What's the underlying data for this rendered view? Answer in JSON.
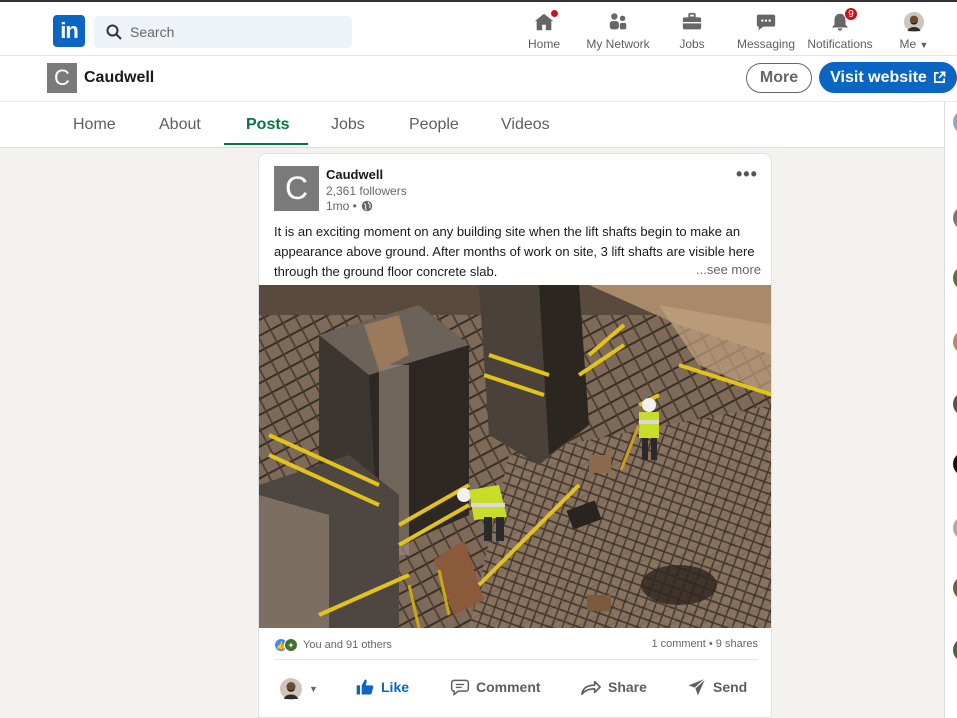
{
  "nav": {
    "logo_text": "in",
    "search_placeholder": "Search",
    "items": [
      {
        "label": "Home",
        "icon": "home-icon"
      },
      {
        "label": "My Network",
        "icon": "network-icon"
      },
      {
        "label": "Jobs",
        "icon": "briefcase-icon"
      },
      {
        "label": "Messaging",
        "icon": "chat-icon"
      },
      {
        "label": "Notifications",
        "icon": "bell-icon",
        "badge": "9"
      },
      {
        "label": "Me",
        "icon": "avatar"
      }
    ]
  },
  "company": {
    "logo_letter": "C",
    "name": "Caudwell",
    "more_label": "More",
    "visit_label": "Visit website"
  },
  "tabs": [
    {
      "label": "Home",
      "active": false
    },
    {
      "label": "About",
      "active": false
    },
    {
      "label": "Posts",
      "active": true
    },
    {
      "label": "Jobs",
      "active": false
    },
    {
      "label": "People",
      "active": false
    },
    {
      "label": "Videos",
      "active": false
    }
  ],
  "post": {
    "logo_letter": "C",
    "author": "Caudwell",
    "followers": "2,361 followers",
    "time": "1mo •",
    "text": "It is an exciting moment on any building site when the lift shafts begin to make an appearance above ground. After months of work on site, 3 lift shafts are visible here through the ground floor concrete slab.",
    "see_more": "...see more",
    "reactions_text": "You and 91 others",
    "engagement": "1 comment • 9 shares",
    "actions": {
      "like": "Like",
      "comment": "Comment",
      "share": "Share",
      "send": "Send"
    }
  },
  "colors": {
    "brand_blue": "#0a66c2",
    "active_tab": "#057642",
    "badge_red": "#cc1016"
  }
}
